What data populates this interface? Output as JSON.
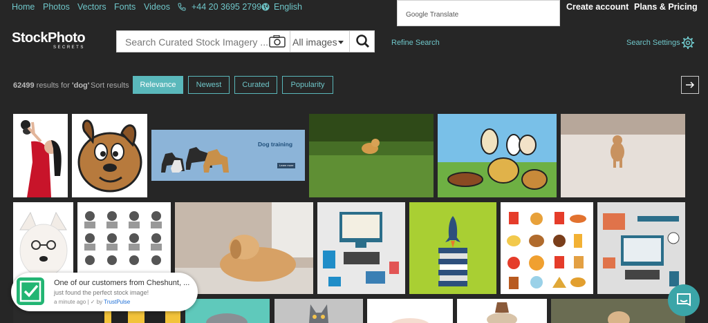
{
  "nav": {
    "home": "Home",
    "photos": "Photos",
    "vectors": "Vectors",
    "fonts": "Fonts",
    "videos": "Videos",
    "phone": "+44 20 3695 2799",
    "language": "English",
    "create_account": "Create account",
    "plans": "Plans & Pricing"
  },
  "translate": {
    "label": "Google Translate"
  },
  "logo": {
    "main": "StockPhoto",
    "sub": "SECRETS"
  },
  "search": {
    "placeholder": "Search Curated Stock Imagery ...",
    "type_selected": "All images"
  },
  "refine": "Refine Search",
  "settings": "Search Settings",
  "results": {
    "count": "62499",
    "text_mid": " results for ",
    "query": "'dog'",
    "sort_label": "Sort results"
  },
  "sort": {
    "options": [
      "Relevance",
      "Newest",
      "Curated",
      "Popularity"
    ],
    "active": "Relevance"
  },
  "dog_training": {
    "title": "Dog training",
    "button": "Learn more"
  },
  "toast": {
    "line1": "One of our customers from Cheshunt, ...",
    "line2": "just found the perfect stock image!",
    "time": "a minute ago",
    "by": "by",
    "brand": "TrustPulse"
  },
  "colors": {
    "accent": "#5ab8bb",
    "bg": "#262626",
    "toast_check": "#22b573"
  }
}
